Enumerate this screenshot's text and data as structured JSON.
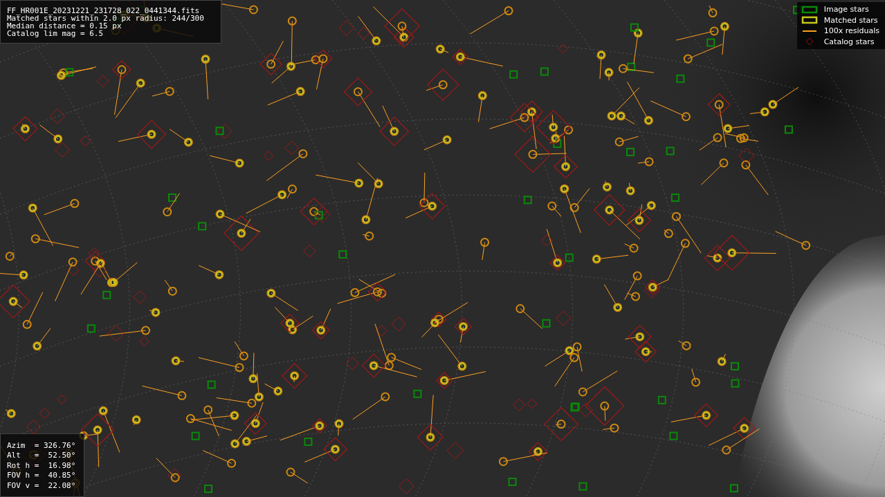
{
  "info_box": {
    "lines": [
      "FF_HR001E_20231221_231728_022_0441344.fits",
      "Matched stars within 2.0 px radius: 244/300",
      "Median distance = 0.15 px",
      "Catalog lim mag = 6.5"
    ]
  },
  "legend": [
    {
      "label": "Image stars",
      "kind": "square",
      "color": "#0a8a0a"
    },
    {
      "label": "Matched stars",
      "kind": "square",
      "color": "#c8c81e"
    },
    {
      "label": "100x residuals",
      "kind": "line",
      "color": "#ffa020"
    },
    {
      "label": "Catalog stars",
      "kind": "diamond",
      "color": "#8a1010"
    }
  ],
  "pointing_box": {
    "lines": [
      "Azim  = 326.76°",
      "Alt   =  52.50°",
      "Rot h =  16.98°",
      "FOV h =  40.85°",
      "FOV v =  22.08°"
    ]
  }
}
